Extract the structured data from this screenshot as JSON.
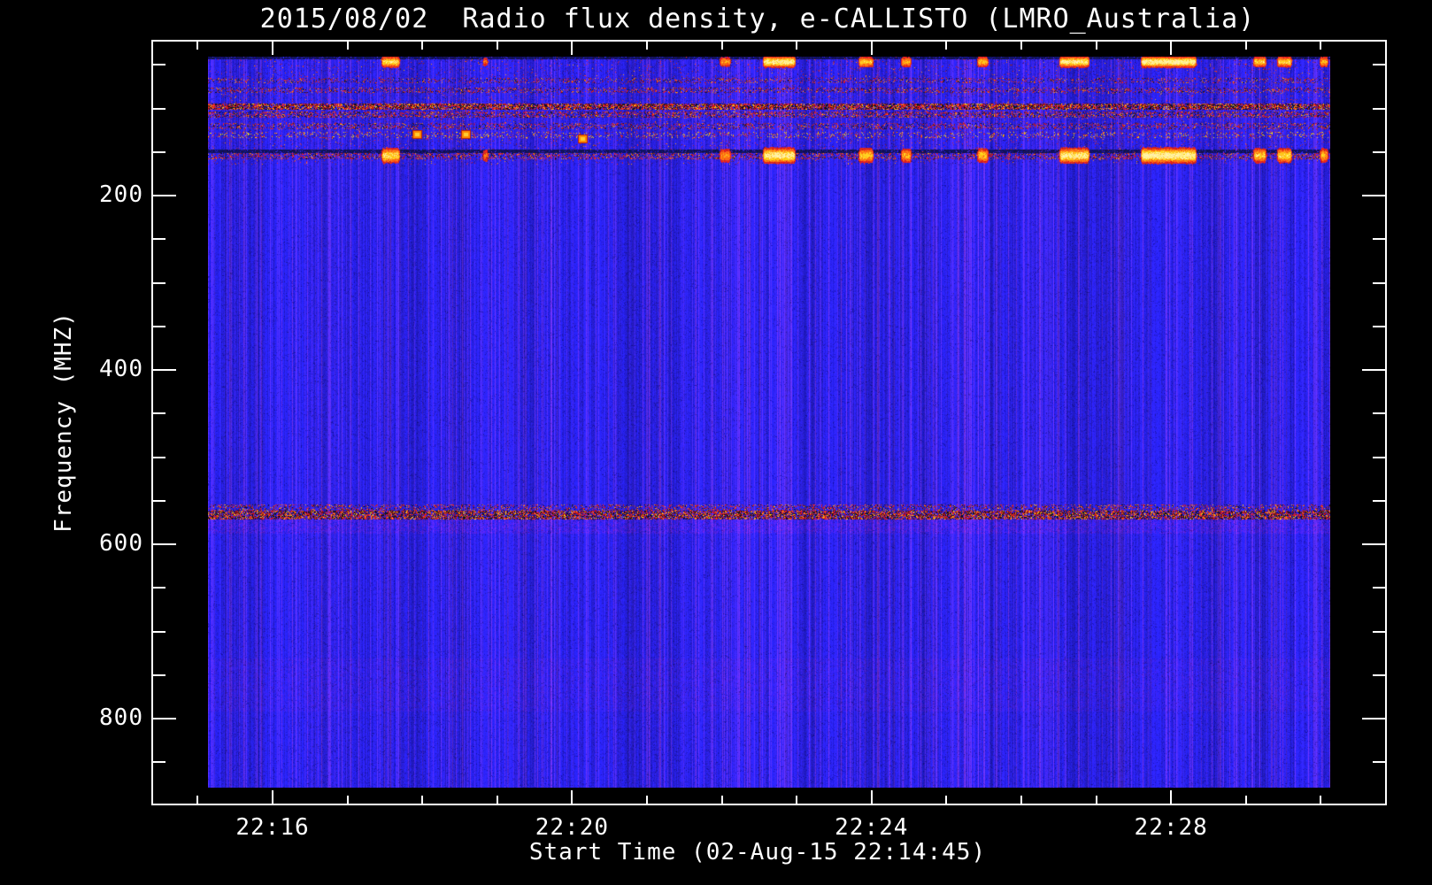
{
  "chart_data": {
    "type": "heatmap",
    "subtype": "radio-spectrogram",
    "title": "2015/08/02  Radio flux density, e-CALLISTO (LMRO_Australia)",
    "date": "2015/08/02",
    "instrument": "e-CALLISTO",
    "station": "LMRO_Australia",
    "xlabel": "Start Time (02-Aug-15 22:14:45)",
    "ylabel": "Frequency (MHZ)",
    "x_axis": {
      "tick_labels": [
        "22:16",
        "22:20",
        "22:24",
        "22:28"
      ],
      "major_tick_interval_min": 4,
      "minor_tick_interval_min": 1,
      "data_start_time": "22:14:45",
      "data_end_time": "22:30:30"
    },
    "y_axis": {
      "tick_labels": [
        "200",
        "400",
        "600",
        "800"
      ],
      "major_step_mhz": 200,
      "minor_step_mhz": 50,
      "data_range_mhz": [
        41,
        880
      ],
      "inverted": true
    },
    "legend": "none",
    "grid": false,
    "colors": {
      "background": "#000000",
      "axes_and_text": "#ffffff",
      "quiet_sky_blue": "#2424e8",
      "speckle_red": "#cc2200",
      "burst_orange": "#ff8800",
      "burst_core_yellow": "#ffee90",
      "rfi_dark": "#000030"
    },
    "noise_region": {
      "y0f": 0.0,
      "y1f": 0.148,
      "density": 0.045
    },
    "rfi_bands": [
      {
        "freq_mhz": 41,
        "style": "dark_row",
        "y0f": 0.0,
        "y1f": 0.0042,
        "density": 0.85,
        "note": "dark top edge row carrying burst flashes"
      },
      {
        "freq_mhz": 68,
        "style": "speckle",
        "y0f": 0.029,
        "y1f": 0.0363,
        "density": 0.22
      },
      {
        "freq_mhz": 79,
        "style": "speckle",
        "y0f": 0.0423,
        "y1f": 0.0496,
        "density": 0.3
      },
      {
        "freq_mhz": 98,
        "style": "speckle_dense",
        "y0f": 0.0641,
        "y1f": 0.0726,
        "density": 0.8,
        "note": "strong RFI line (FM broadcast band)"
      },
      {
        "freq_mhz": 107,
        "style": "speckle",
        "y0f": 0.075,
        "y1f": 0.0834,
        "density": 0.45
      },
      {
        "freq_mhz": 120,
        "style": "speckle",
        "y0f": 0.0907,
        "y1f": 0.0992,
        "density": 0.28
      },
      {
        "freq_mhz": 129,
        "style": "speckle_warm",
        "y0f": 0.1028,
        "y1f": 0.1112,
        "density": 0.14
      },
      {
        "freq_mhz": 151,
        "style": "dark_row",
        "y0f": 0.127,
        "y1f": 0.1318,
        "density": 0.6
      },
      {
        "freq_mhz": 153,
        "style": "speckle",
        "y0f": 0.1318,
        "y1f": 0.1403,
        "density": 0.38
      },
      {
        "freq_mhz": 558,
        "style": "speckle",
        "y0f": 0.6131,
        "y1f": 0.6215,
        "density": 0.32
      },
      {
        "freq_mhz": 566,
        "style": "speckle_dense",
        "y0f": 0.6215,
        "y1f": 0.6336,
        "density": 0.72,
        "note": "persistent RFI line across full duration"
      },
      {
        "freq_mhz": 576,
        "style": "tint",
        "y0f": 0.6336,
        "y1f": 0.653,
        "density": 0.12
      },
      {
        "freq_mhz": 765,
        "style": "tint",
        "y0f": 0.8235,
        "y1f": 0.8961,
        "density": 0.05
      }
    ],
    "burst_rows": [
      {
        "freq_mhz": 45,
        "center_f": 0.0067,
        "sigma_f": 0.004
      },
      {
        "freq_mhz": 153,
        "center_f": 0.1348,
        "sigma_f": 0.0056
      }
    ],
    "bursts": [
      {
        "time": "22:17:32",
        "duration_s": 15,
        "intensity": 0.8,
        "x0f": 0.1542,
        "x1f": 0.1707
      },
      {
        "time": "22:18:49",
        "duration_s": 4,
        "intensity": 0.35,
        "x0f": 0.2447,
        "x1f": 0.2494
      },
      {
        "time": "22:22:01",
        "duration_s": 9,
        "intensity": 0.5,
        "x0f": 0.4556,
        "x1f": 0.465
      },
      {
        "time": "22:22:44",
        "duration_s": 26,
        "intensity": 0.95,
        "x0f": 0.4941,
        "x1f": 0.5232
      },
      {
        "time": "22:23:55",
        "duration_s": 11,
        "intensity": 0.7,
        "x0f": 0.5799,
        "x1f": 0.5925
      },
      {
        "time": "22:24:26",
        "duration_s": 8,
        "intensity": 0.6,
        "x0f": 0.6176,
        "x1f": 0.6263
      },
      {
        "time": "22:25:28",
        "duration_s": 9,
        "intensity": 0.65,
        "x0f": 0.6853,
        "x1f": 0.6947
      },
      {
        "time": "22:26:41",
        "duration_s": 23,
        "intensity": 0.9,
        "x0f": 0.7585,
        "x1f": 0.7844
      },
      {
        "time": "22:27:58",
        "duration_s": 44,
        "intensity": 1.0,
        "x0f": 0.8316,
        "x1f": 0.8804
      },
      {
        "time": "22:29:11",
        "duration_s": 10,
        "intensity": 0.7,
        "x0f": 0.9316,
        "x1f": 0.9426
      },
      {
        "time": "22:29:31",
        "duration_s": 11,
        "intensity": 0.75,
        "x0f": 0.9528,
        "x1f": 0.9654
      },
      {
        "time": "22:30:02",
        "duration_s": 6,
        "intensity": 0.6,
        "x0f": 0.9906,
        "x1f": 0.9977
      }
    ],
    "specks": [
      {
        "x_f": 0.3336,
        "y_f": 0.1125
      },
      {
        "x_f": 0.1864,
        "y_f": 0.1064
      },
      {
        "x_f": 0.2297,
        "y_f": 0.1064
      }
    ]
  }
}
